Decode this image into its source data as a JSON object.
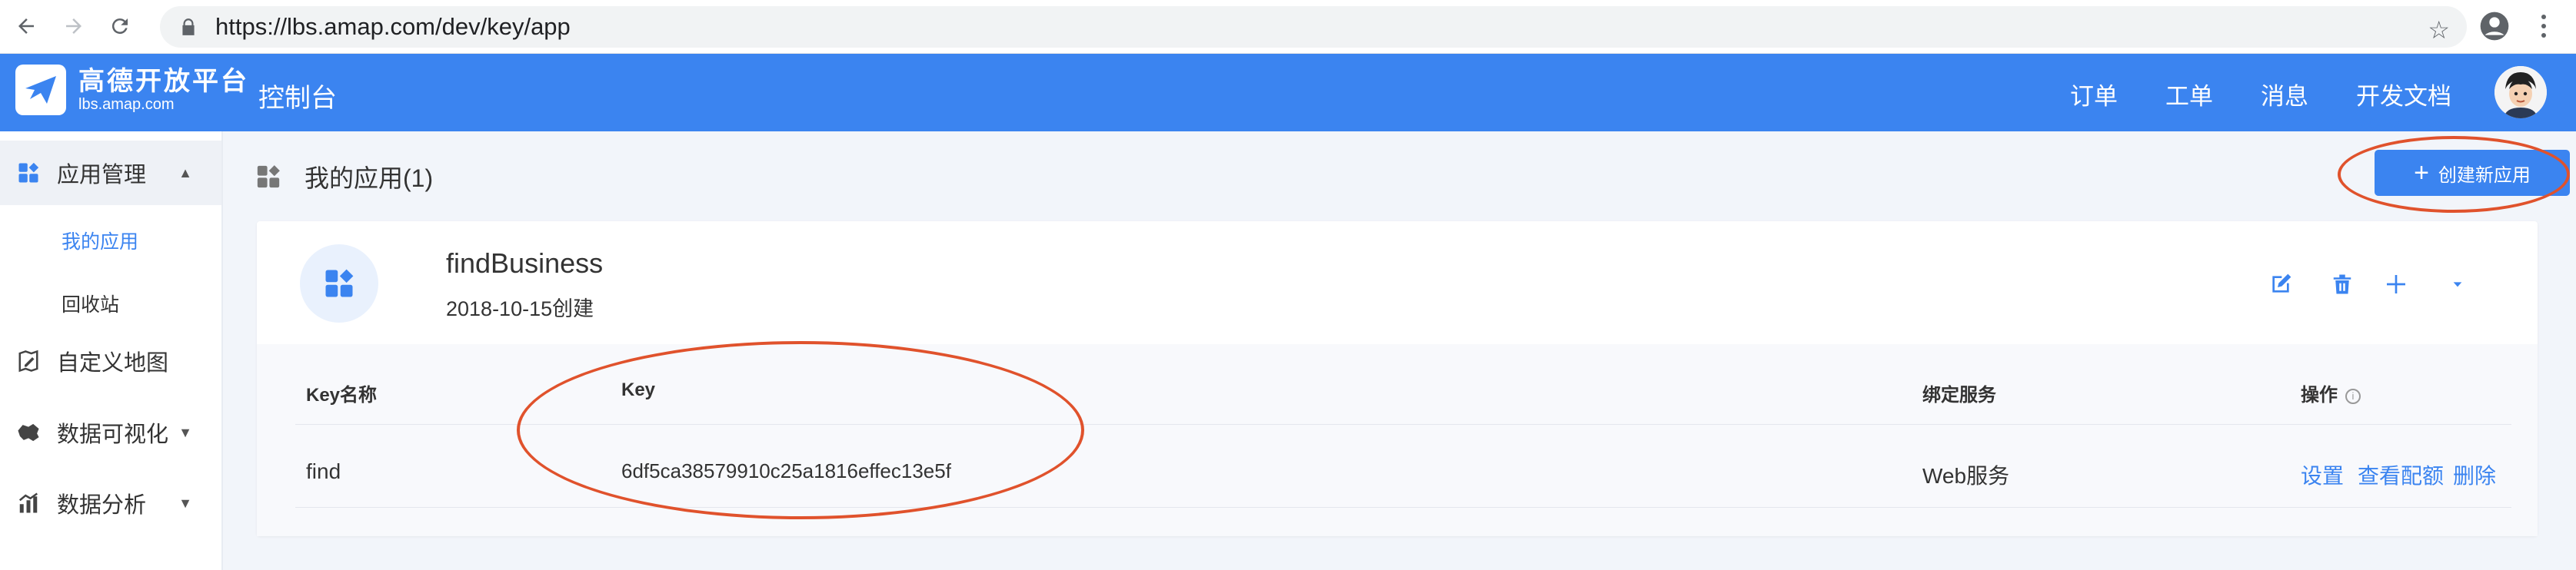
{
  "browser": {
    "url": "https://lbs.amap.com/dev/key/app"
  },
  "header": {
    "logo_name": "高德开放平台",
    "logo_domain": "lbs.amap.com",
    "console_label": "控制台",
    "nav": {
      "orders": "订单",
      "tickets": "工单",
      "messages": "消息",
      "docs": "开发文档"
    },
    "brand_color": "#3b84f0"
  },
  "sidebar": {
    "app_management": "应用管理",
    "my_apps": "我的应用",
    "recycle_bin": "回收站",
    "custom_map": "自定义地图",
    "data_viz": "数据可视化",
    "data_analysis": "数据分析"
  },
  "main": {
    "page_title": "我的应用(1)",
    "create_button": "创建新应用",
    "app": {
      "name": "findBusiness",
      "created": "2018-10-15创建"
    },
    "table": {
      "headers": {
        "key_name": "Key名称",
        "key": "Key",
        "service": "绑定服务",
        "operations": "操作"
      },
      "rows": [
        {
          "key_name": "find",
          "key": "6df5ca38579910c25a1816effec13e5f",
          "service": "Web服务",
          "ops": {
            "settings": "设置",
            "quota": "查看配额",
            "delete": "删除"
          }
        }
      ]
    }
  },
  "annotation_color": "#e0522c"
}
